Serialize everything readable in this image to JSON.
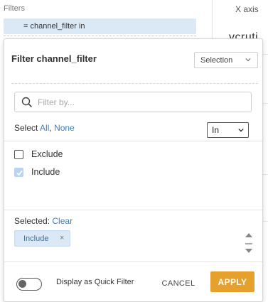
{
  "background": {
    "filters_label": "Filters",
    "x_axis_label": "X axis",
    "active_filter_chip": "= channel_filter in",
    "cut_off_text": "vcruti"
  },
  "popup": {
    "title": "Filter channel_filter",
    "mode_select": {
      "value": "Selection",
      "icon": "chevron-down-icon"
    },
    "search": {
      "placeholder": "Filter by...",
      "value": "",
      "icon": "search-icon"
    },
    "select_prefix": "Select",
    "select_all": "All",
    "select_separator": ",",
    "select_none": "None",
    "operator_select": {
      "value": "In"
    },
    "items": [
      {
        "label": "Exclude",
        "checked": false
      },
      {
        "label": "Include",
        "checked": true
      }
    ],
    "selected_label": "Selected:",
    "clear_link": "Clear",
    "selected_pills": [
      {
        "label": "Include",
        "remove_glyph": "×"
      }
    ],
    "quick_filter_toggle": {
      "label": "Display as Quick Filter",
      "on": false
    },
    "cancel_label": "CANCEL",
    "apply_label": "APPLY"
  },
  "colors": {
    "accent_link": "#3f7ec2",
    "apply_button": "#e6a02d",
    "chip_background": "#dbe9f7",
    "checked_box": "#b9d4ee"
  }
}
